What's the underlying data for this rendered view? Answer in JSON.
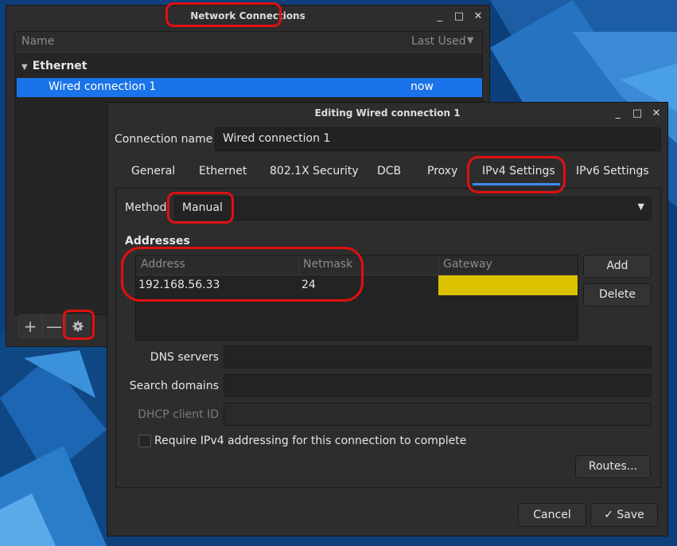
{
  "network_connections": {
    "title": "Network Connections",
    "window_buttons": {
      "minimize": "_",
      "maximize": "□",
      "close": "✕"
    },
    "columns": {
      "name": "Name",
      "last_used": "Last Used"
    },
    "group": "Ethernet",
    "rows": [
      {
        "name": "Wired connection 1",
        "last_used": "now"
      }
    ],
    "toolbar": {
      "add": "+",
      "remove": "—"
    }
  },
  "editor": {
    "title": "Editing Wired connection 1",
    "connection_name_label": "Connection name",
    "connection_name": "Wired connection 1",
    "tabs": [
      "General",
      "Ethernet",
      "802.1X Security",
      "DCB",
      "Proxy",
      "IPv4 Settings",
      "IPv6 Settings"
    ],
    "active_tab": "IPv4 Settings",
    "method_label": "Method",
    "method_value": "Manual",
    "addresses_label": "Addresses",
    "address_columns": {
      "address": "Address",
      "netmask": "Netmask",
      "gateway": "Gateway"
    },
    "address_rows": [
      {
        "address": "192.168.56.33",
        "netmask": "24",
        "gateway": ""
      }
    ],
    "add_label": "Add",
    "delete_label": "Delete",
    "dns_label": "DNS servers",
    "search_label": "Search domains",
    "dhcp_label": "DHCP client ID",
    "require_label": "Require IPv4 addressing for this connection to complete",
    "require_checked": false,
    "routes_label": "Routes...",
    "cancel_label": "Cancel",
    "save_label": "Save"
  },
  "colors": {
    "selection": "#1a73e8",
    "gateway_highlight": "#dcc100",
    "annotation": "#e01010",
    "tab_underline": "#3a8cf0"
  }
}
